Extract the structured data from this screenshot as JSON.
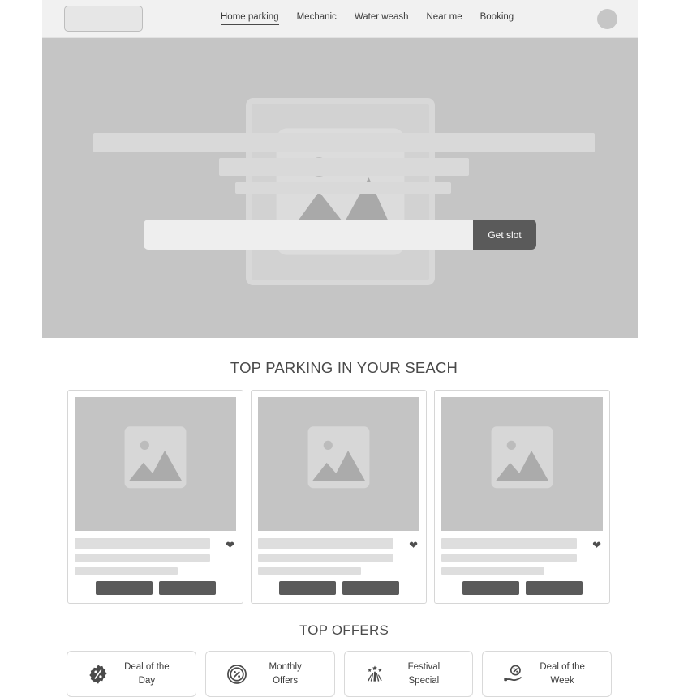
{
  "header": {
    "logo_placeholder": "",
    "nav": [
      {
        "label": "Home parking",
        "active": true
      },
      {
        "label": "Mechanic",
        "active": false
      },
      {
        "label": "Water weash",
        "active": false
      },
      {
        "label": "Near me",
        "active": false
      },
      {
        "label": "Booking",
        "active": false
      }
    ],
    "avatar_icon": "avatar-circle-icon"
  },
  "hero": {
    "image_placeholder_icon": "image-placeholder-icon",
    "search_value": "",
    "search_placeholder": "",
    "cta_label": "Get slot"
  },
  "sections": {
    "parking_title": "TOP PARKING IN YOUR SEACH",
    "offers_title": "TOP OFFERS"
  },
  "parking_cards": [
    {
      "image_icon": "image-placeholder-icon",
      "favorite_icon": "heart-icon",
      "primary_button": "",
      "secondary_button": ""
    },
    {
      "image_icon": "image-placeholder-icon",
      "favorite_icon": "heart-icon",
      "primary_button": "",
      "secondary_button": ""
    },
    {
      "image_icon": "image-placeholder-icon",
      "favorite_icon": "heart-icon",
      "primary_button": "",
      "secondary_button": ""
    }
  ],
  "offers": [
    {
      "label": "Deal of the Day",
      "icon": "percent-badge-icon"
    },
    {
      "label": "Monthly Offers",
      "icon": "percent-circle-icon"
    },
    {
      "label": "Festival Special",
      "icon": "firework-icon"
    },
    {
      "label": "Deal of the Week",
      "icon": "hand-percent-icon"
    }
  ],
  "colors": {
    "header_bg": "#f1f1f1",
    "hero_bg": "#c5c5c5",
    "accent_dark": "#5a5a5a",
    "skeleton": "#dedede",
    "page_bg": "#ffffff"
  }
}
